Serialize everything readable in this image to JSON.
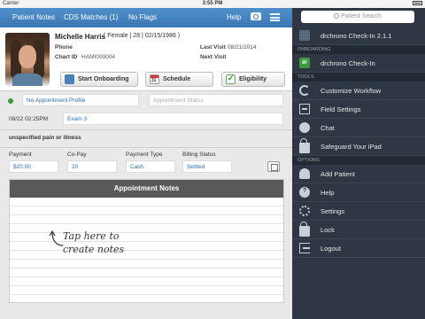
{
  "status_bar": {
    "carrier": "Carrier",
    "time": "3:55 PM"
  },
  "navbar": {
    "tabs": [
      "Patient Notes",
      "CDS Matches (1)",
      "No Flags"
    ],
    "help": "Help"
  },
  "patient": {
    "name": "Michelle Harris",
    "meta": "( Female | 28 | 02/15/1986 )",
    "phone_label": "Phone",
    "chart_label": "Chart ID",
    "chart_id": "HAMI000004",
    "last_visit_label": "Last Visit",
    "last_visit": "08/21/2014",
    "next_visit_label": "Next Visit"
  },
  "actions": {
    "onboarding": "Start Onboarding",
    "schedule": "Schedule",
    "schedule_day": "31",
    "eligibility": "Eligibility"
  },
  "appointment": {
    "profile": "No Appointment Profile",
    "status_placeholder": "Appointment Status",
    "datetime": "08/22 02:25PM",
    "exam_room": "Exam 3",
    "reason": "unspecified pain or illness"
  },
  "billing": {
    "headers": [
      "Payment",
      "Co-Pay",
      "Payment Type",
      "Billing Status"
    ],
    "values": [
      "$20.00",
      "20",
      "Cash",
      "Settled"
    ]
  },
  "notes": {
    "header": "Appointment Notes",
    "hint_line1": "Tap here to",
    "hint_line2": "create notes"
  },
  "sidebar": {
    "search_placeholder": "Patient Search",
    "app_title": "drchrono Check-In 2.1.1",
    "sections": {
      "onboarding": "ONBOARDING",
      "tools": "TOOLS",
      "options": "OPTIONS"
    },
    "onboarding_items": [
      {
        "label": "drchrono Check-In",
        "icon": "dr-logo-icon"
      }
    ],
    "tool_items": [
      {
        "label": "Customize Workflow",
        "icon": "workflow-icon"
      },
      {
        "label": "Field Settings",
        "icon": "field-settings-icon"
      },
      {
        "label": "Chat",
        "icon": "chat-icon"
      },
      {
        "label": "Safeguard Your iPad",
        "icon": "lock-icon"
      }
    ],
    "option_items": [
      {
        "label": "Add Patient",
        "icon": "add-patient-icon"
      },
      {
        "label": "Help",
        "icon": "help-icon"
      },
      {
        "label": "Settings",
        "icon": "gear-icon"
      },
      {
        "label": "Lock",
        "icon": "lock-icon"
      },
      {
        "label": "Logout",
        "icon": "logout-icon"
      }
    ]
  },
  "colors": {
    "nav_blue": "#3a78b4",
    "sidebar_bg": "#2e3743",
    "link_blue": "#2a6cb0",
    "status_green": "#3c9a3c"
  }
}
